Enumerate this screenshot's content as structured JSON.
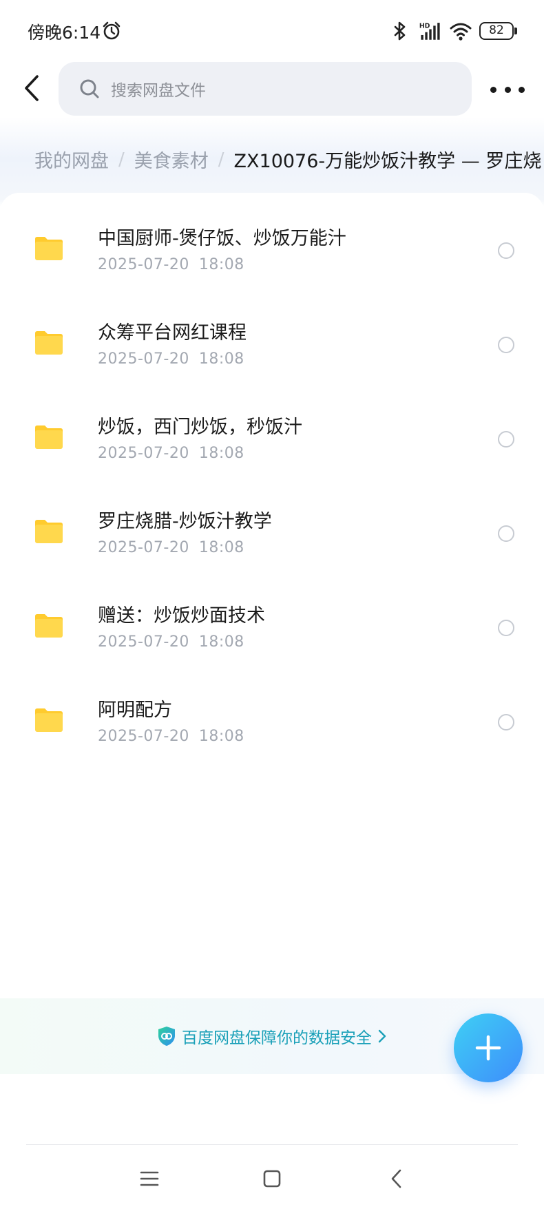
{
  "status_bar": {
    "time": "傍晚6:14",
    "battery": "82",
    "icons": [
      "alarm-icon",
      "bluetooth-icon",
      "hd-signal-icon",
      "wifi-icon",
      "battery-icon"
    ]
  },
  "header": {
    "search_placeholder": "搜索网盘文件",
    "icons": [
      "back-arrow-icon",
      "search-icon",
      "more-icon"
    ]
  },
  "breadcrumb": {
    "items": [
      "我的网盘",
      "美食素材"
    ],
    "separator": "/",
    "current": "ZX10076-万能炒饭汁教学 — 罗庄烧"
  },
  "files": [
    {
      "name": "中国厨师-煲仔饭、炒饭万能汁",
      "date": "2025-07-20",
      "time": "18:08"
    },
    {
      "name": "众筹平台网红课程",
      "date": "2025-07-20",
      "time": "18:08"
    },
    {
      "name": "炒饭，西门炒饭，秒饭汁",
      "date": "2025-07-20",
      "time": "18:08"
    },
    {
      "name": "罗庄烧腊-炒饭汁教学",
      "date": "2025-07-20",
      "time": "18:08"
    },
    {
      "name": "赠送：炒饭炒面技术",
      "date": "2025-07-20",
      "time": "18:08"
    },
    {
      "name": "阿明配方",
      "date": "2025-07-20",
      "time": "18:08"
    }
  ],
  "banner": {
    "text": "百度网盘保障你的数据安全"
  },
  "colors": {
    "folder": "#FFD84D",
    "folder_tab": "#FFCB2E",
    "accent": "#1AA0B8",
    "fab_start": "#3FD0F5",
    "fab_end": "#3D8DFB"
  }
}
